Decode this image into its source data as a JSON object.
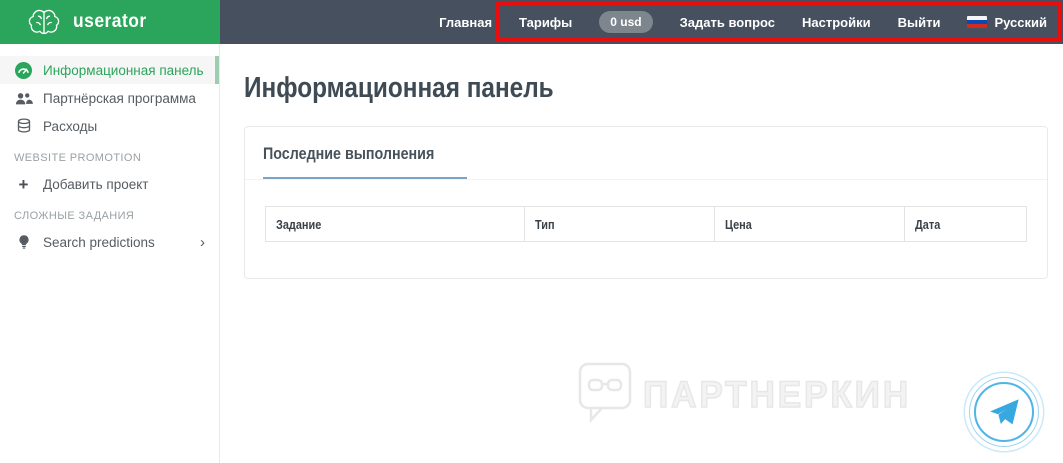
{
  "brand": {
    "name": "userator"
  },
  "nav": {
    "items": [
      {
        "label": "Главная"
      },
      {
        "label": "Тарифы"
      },
      {
        "label": "0 usd",
        "type": "balance-badge"
      },
      {
        "label": "Задать вопрос"
      },
      {
        "label": "Настройки"
      },
      {
        "label": "Выйти"
      },
      {
        "label": "Русский",
        "type": "language",
        "icon": "russian-flag-icon"
      }
    ]
  },
  "annotation": {
    "shape": "rectangle",
    "color": "#ea0d0d",
    "around": "top navigation items"
  },
  "sidebar": {
    "items": [
      {
        "label": "Информационная панель",
        "icon": "dashboard-gauge-icon",
        "active": true
      },
      {
        "label": "Партнёрская программа",
        "icon": "users-icon",
        "active": false
      },
      {
        "label": "Расходы",
        "icon": "coins-icon",
        "active": false
      }
    ],
    "section_website_promotion": "WEBSITE PROMOTION",
    "add_project": {
      "label": "Добавить проект",
      "icon": "plus-icon"
    },
    "section_complex_tasks": "СЛОЖНЫЕ ЗАДАНИЯ",
    "search_predictions": {
      "label": "Search predictions",
      "icon": "lightbulb-icon",
      "chevron": "›"
    }
  },
  "main": {
    "title": "Информационная панель",
    "card": {
      "tab": "Последние выполнения",
      "table": {
        "headers": [
          "Задание",
          "Тип",
          "Цена",
          "Дата"
        ],
        "rows": []
      }
    }
  },
  "watermark": {
    "text": "ПАРТНЕРКИН"
  },
  "colors": {
    "brand_green": "#2ba55b",
    "navbar_dark": "#46505f",
    "annotation_red": "#ea0d0d",
    "active_item_green": "#2ba55b",
    "tab_underline_blue": "#7aa3c4",
    "badge_gray": "#7e868d",
    "telegram_blue": "#37a8e0"
  }
}
